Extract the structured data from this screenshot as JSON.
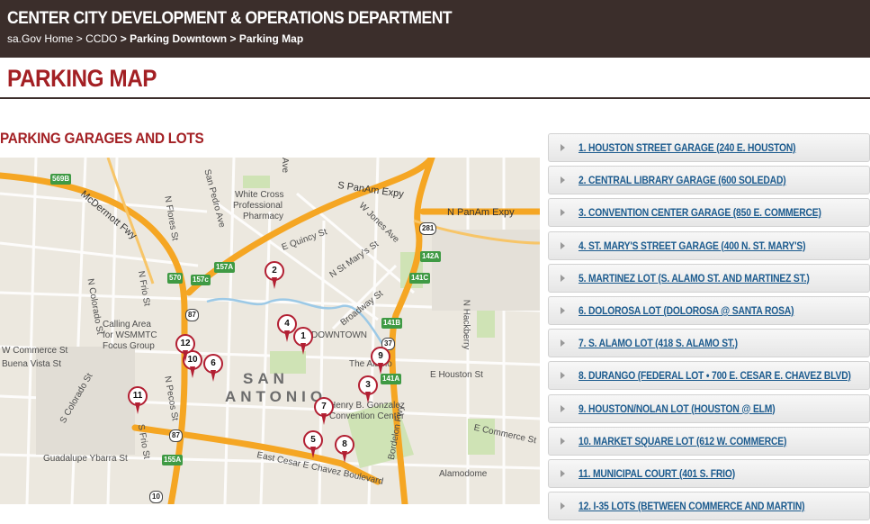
{
  "header": {
    "department": "CENTER CITY DEVELOPMENT & OPERATIONS DEPARTMENT",
    "breadcrumb": [
      "sa.Gov Home",
      "CCDO",
      "Parking Downtown",
      "Parking Map"
    ],
    "separator": ">"
  },
  "page_title": "PARKING MAP",
  "section_title": "PARKING GARAGES AND LOTS",
  "map": {
    "labels": {
      "mcdermott": "McDermott Fwy",
      "n_flores": "N Flores St",
      "san_pedro": "San Pedro Ave",
      "white_cross": "White Cross",
      "professional": "Professional",
      "pharmacy": "Pharmacy",
      "s_panam": "S PanAm Expy",
      "n_panam": "N PanAm Expy",
      "e_quincy": "E Quincy St",
      "w_jones": "W Jones Ave",
      "n_st_marys": "N St Mary's St",
      "broadway": "Broadway St",
      "n_frio": "N Frio St",
      "n_colorado": "N Colorado St",
      "calling_area": "Calling Area",
      "for_wsmmtc": "for WSMMTC",
      "focus_group": "Focus Group",
      "w_commerce": "W Commerce St",
      "buena_vista": "Buena Vista St",
      "s_colorado": "S Colorado St",
      "n_pecos": "N Pecos St",
      "san": "SAN",
      "antonio": "ANTONIO",
      "downtown": "DOWNTOWN",
      "the_alamo": "The Alamo",
      "e_houston": "E Houston St",
      "henry_b": "Henry B. Gonzalez",
      "convention_center": "Convention Center",
      "e_commerce": "E Commerce St",
      "bordelon": "Bordelon Fwy",
      "guadalupe": "Guadalupe Ybarra St",
      "east_cesar": "East Cesar E Chavez Boulevard",
      "alamodome": "Alamodome",
      "n_hackberry": "N Hackberry",
      "s_frio": "S Frio St",
      "ave": "Ave"
    },
    "shields": [
      "569B",
      "157A",
      "157c",
      "570",
      "87",
      "281",
      "142A",
      "141C",
      "141B",
      "37",
      "141A",
      "87",
      "155A",
      "10",
      "141A"
    ],
    "pins": [
      "1",
      "2",
      "3",
      "4",
      "5",
      "6",
      "7",
      "8",
      "9",
      "10",
      "11",
      "12"
    ]
  },
  "locations": [
    "1. HOUSTON STREET GARAGE (240 E. HOUSTON)",
    "2. CENTRAL LIBRARY GARAGE (600 SOLEDAD)",
    "3. CONVENTION CENTER GARAGE (850 E. COMMERCE)",
    "4. ST. MARY'S STREET GARAGE (400 N. ST. MARY'S)",
    "5. MARTINEZ LOT (S. ALAMO ST. AND MARTINEZ ST.)",
    "6. DOLOROSA LOT (DOLOROSA @ SANTA ROSA)",
    "7. S. ALAMO LOT (418 S. ALAMO ST.)",
    "8. DURANGO (FEDERAL LOT • 700 E. CESAR E. CHAVEZ BLVD)",
    "9. HOUSTON/NOLAN LOT (HOUSTON @ ELM)",
    "10. MARKET SQUARE LOT (612 W. COMMERCE)",
    "11. MUNICIPAL COURT (401 S. FRIO)",
    "12. I-35 LOTS (BETWEEN COMMERCE AND MARTIN)"
  ],
  "colors": {
    "header_bg": "#3b2e2b",
    "accent_red": "#a32024",
    "link_blue": "#1c5b8e",
    "freeway_orange": "#f5a623",
    "pin_red": "#b21f32"
  }
}
